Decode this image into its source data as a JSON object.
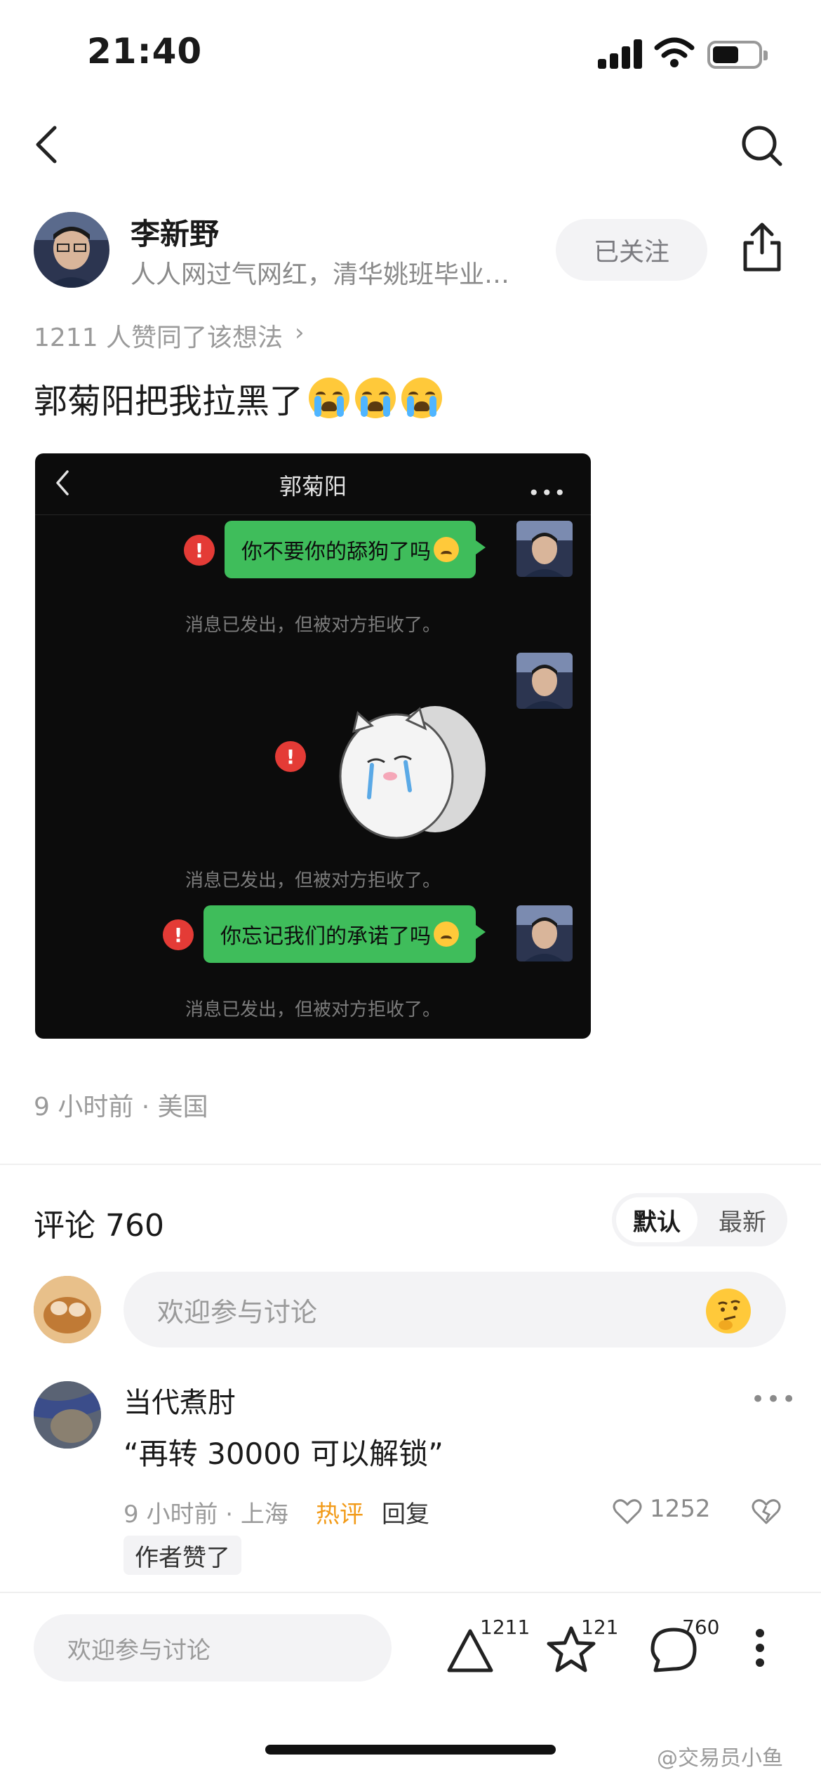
{
  "status_bar": {
    "time": "21:40"
  },
  "author": {
    "name": "李新野",
    "bio": "人人网过气网红，清华姚班毕业…",
    "follow_label": "已关注"
  },
  "post": {
    "agree_text": "1211 人赞同了该想法",
    "agree_chevron": "›",
    "title": "郭菊阳把我拉黑了",
    "meta": "9 小时前 · 美国"
  },
  "embedded_chat": {
    "title": "郭菊阳",
    "more": "•••",
    "messages": [
      {
        "text": "你不要你的舔狗了吗",
        "error": "!"
      },
      {
        "text": "你忘记我们的承诺了吗",
        "error": "!"
      }
    ],
    "sticker_error": "!",
    "notice": "消息已发出，但被对方拒收了。"
  },
  "comments": {
    "title": "评论 760",
    "sort_options": [
      "默认",
      "最新"
    ],
    "input_placeholder": "欢迎参与讨论",
    "items": [
      {
        "user": "当代煮肘",
        "text": "“再转 30000 可以解锁”",
        "meta": "9 小时前 · 上海",
        "hot_label": "热评",
        "reply_label": "回复",
        "likes": "1252",
        "author_liked": "作者赞了",
        "more": "•••"
      }
    ]
  },
  "bottom_bar": {
    "input_placeholder": "欢迎参与讨论",
    "agree_count": "1211",
    "favorite_count": "121",
    "comment_count": "760"
  },
  "watermark": "@交易员小鱼",
  "colors": {
    "hot": "#f29b19",
    "chat_bubble": "#3fbd5b",
    "error": "#e43b36"
  }
}
